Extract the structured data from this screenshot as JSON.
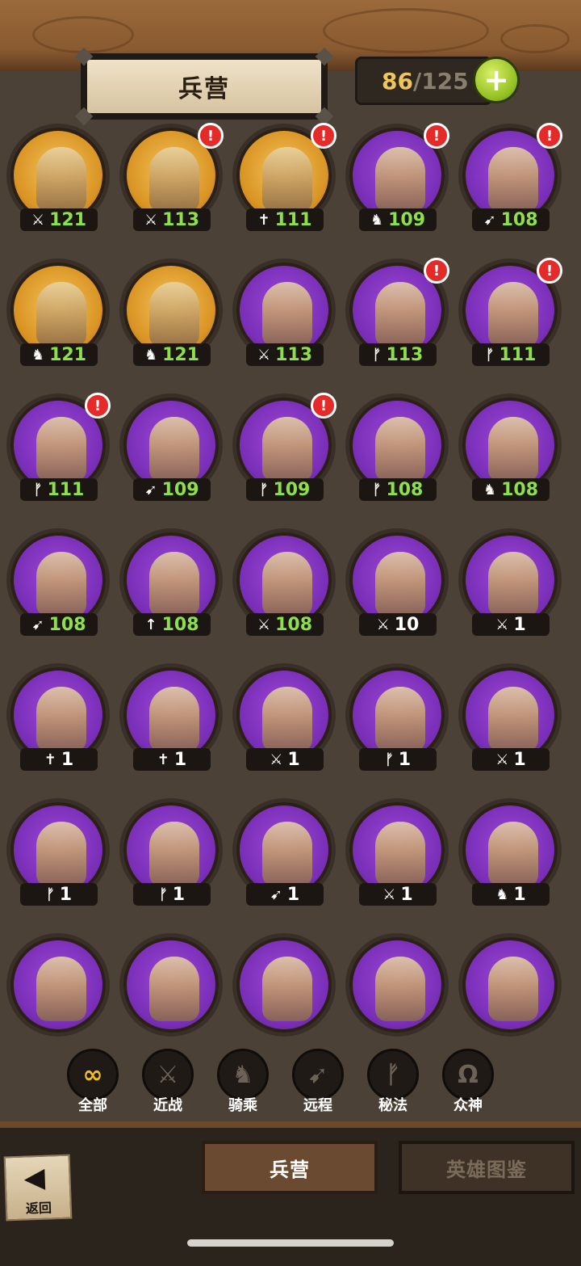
{
  "header": {
    "title": "兵营",
    "count_current": "86",
    "count_separator": "/",
    "count_max": "125",
    "add_button": "+"
  },
  "units": [
    {
      "tier": "gold",
      "type": "melee",
      "level": "121",
      "level_color": "green",
      "alert": false
    },
    {
      "tier": "gold",
      "type": "melee",
      "level": "113",
      "level_color": "green",
      "alert": true
    },
    {
      "tier": "gold",
      "type": "divine",
      "level": "111",
      "level_color": "green",
      "alert": true
    },
    {
      "tier": "purple",
      "type": "mounted",
      "level": "109",
      "level_color": "green",
      "alert": true
    },
    {
      "tier": "purple",
      "type": "ranged",
      "level": "108",
      "level_color": "green",
      "alert": true
    },
    {
      "tier": "gold",
      "type": "mounted",
      "level": "121",
      "level_color": "green",
      "alert": false
    },
    {
      "tier": "gold",
      "type": "mounted",
      "level": "121",
      "level_color": "green",
      "alert": false
    },
    {
      "tier": "purple",
      "type": "melee",
      "level": "113",
      "level_color": "green",
      "alert": false
    },
    {
      "tier": "purple",
      "type": "magic",
      "level": "113",
      "level_color": "green",
      "alert": true
    },
    {
      "tier": "purple",
      "type": "magic",
      "level": "111",
      "level_color": "green",
      "alert": true
    },
    {
      "tier": "purple",
      "type": "magic",
      "level": "111",
      "level_color": "green",
      "alert": true
    },
    {
      "tier": "purple",
      "type": "ranged",
      "level": "109",
      "level_color": "green",
      "alert": false
    },
    {
      "tier": "purple",
      "type": "magic",
      "level": "109",
      "level_color": "green",
      "alert": true
    },
    {
      "tier": "purple",
      "type": "magic",
      "level": "108",
      "level_color": "green",
      "alert": false
    },
    {
      "tier": "purple",
      "type": "mounted",
      "level": "108",
      "level_color": "green",
      "alert": false
    },
    {
      "tier": "purple",
      "type": "ranged",
      "level": "108",
      "level_color": "green",
      "alert": false
    },
    {
      "tier": "purple",
      "type": "spear",
      "level": "108",
      "level_color": "green",
      "alert": false
    },
    {
      "tier": "purple",
      "type": "melee",
      "level": "108",
      "level_color": "green",
      "alert": false
    },
    {
      "tier": "purple",
      "type": "melee",
      "level": "10",
      "level_color": "white",
      "alert": false
    },
    {
      "tier": "purple",
      "type": "melee",
      "level": "1",
      "level_color": "white",
      "alert": false
    },
    {
      "tier": "purple",
      "type": "divine",
      "level": "1",
      "level_color": "white",
      "alert": false
    },
    {
      "tier": "purple",
      "type": "divine",
      "level": "1",
      "level_color": "white",
      "alert": false
    },
    {
      "tier": "purple",
      "type": "melee",
      "level": "1",
      "level_color": "white",
      "alert": false
    },
    {
      "tier": "purple",
      "type": "magic",
      "level": "1",
      "level_color": "white",
      "alert": false
    },
    {
      "tier": "purple",
      "type": "melee",
      "level": "1",
      "level_color": "white",
      "alert": false
    },
    {
      "tier": "purple",
      "type": "magic",
      "level": "1",
      "level_color": "white",
      "alert": false
    },
    {
      "tier": "purple",
      "type": "magic",
      "level": "1",
      "level_color": "white",
      "alert": false
    },
    {
      "tier": "purple",
      "type": "ranged",
      "level": "1",
      "level_color": "white",
      "alert": false
    },
    {
      "tier": "purple",
      "type": "melee",
      "level": "1",
      "level_color": "white",
      "alert": false
    },
    {
      "tier": "purple",
      "type": "mounted",
      "level": "1",
      "level_color": "white",
      "alert": false
    },
    {
      "tier": "purple",
      "type": "melee",
      "level": "",
      "level_color": "white",
      "alert": false
    },
    {
      "tier": "purple",
      "type": "magic",
      "level": "",
      "level_color": "white",
      "alert": false
    },
    {
      "tier": "purple",
      "type": "mounted",
      "level": "",
      "level_color": "white",
      "alert": false
    },
    {
      "tier": "purple",
      "type": "ranged",
      "level": "",
      "level_color": "white",
      "alert": false
    },
    {
      "tier": "purple",
      "type": "melee",
      "level": "",
      "level_color": "white",
      "alert": false
    }
  ],
  "type_icons": {
    "melee": "sword-icon",
    "mounted": "horse-icon",
    "ranged": "bow-icon",
    "magic": "staff-icon",
    "divine": "cross-icon",
    "spear": "spear-icon"
  },
  "filters": [
    {
      "label": "全部",
      "icon": "infinity-icon",
      "glyph": "∞",
      "active": true
    },
    {
      "label": "近战",
      "icon": "sword-icon",
      "glyph": "⚔",
      "active": false
    },
    {
      "label": "骑乘",
      "icon": "horse-icon",
      "glyph": "♞",
      "active": false
    },
    {
      "label": "远程",
      "icon": "bow-icon",
      "glyph": "➹",
      "active": false
    },
    {
      "label": "秘法",
      "icon": "rune-icon",
      "glyph": "ᚠ",
      "active": false
    },
    {
      "label": "众神",
      "icon": "omega-icon",
      "glyph": "Ω",
      "active": false
    }
  ],
  "bottom": {
    "back_label": "返回",
    "tab_barracks": "兵营",
    "tab_codex": "英雄图鉴"
  },
  "colors": {
    "gold_badge": "#d99424",
    "purple_badge": "#7a2fb8",
    "level_green": "#8ee04a",
    "alert_red": "#e52a2a",
    "plus_green": "#8fbd1d"
  }
}
